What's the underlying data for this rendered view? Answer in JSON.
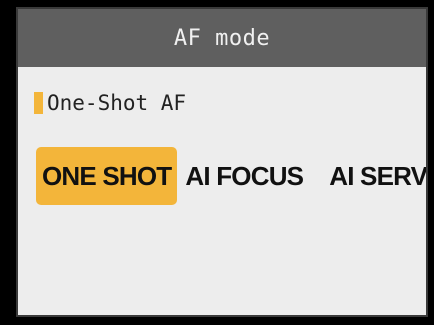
{
  "header": {
    "title": "AF mode"
  },
  "current_setting": {
    "label": "One-Shot AF"
  },
  "options": [
    {
      "label": "ONE SHOT",
      "selected": true
    },
    {
      "label": "AI FOCUS",
      "selected": false
    },
    {
      "label": "AI SERVO",
      "selected": false
    }
  ],
  "colors": {
    "highlight": "#f3b53a",
    "title_bar": "#5f5f5f",
    "background": "#ededed"
  }
}
